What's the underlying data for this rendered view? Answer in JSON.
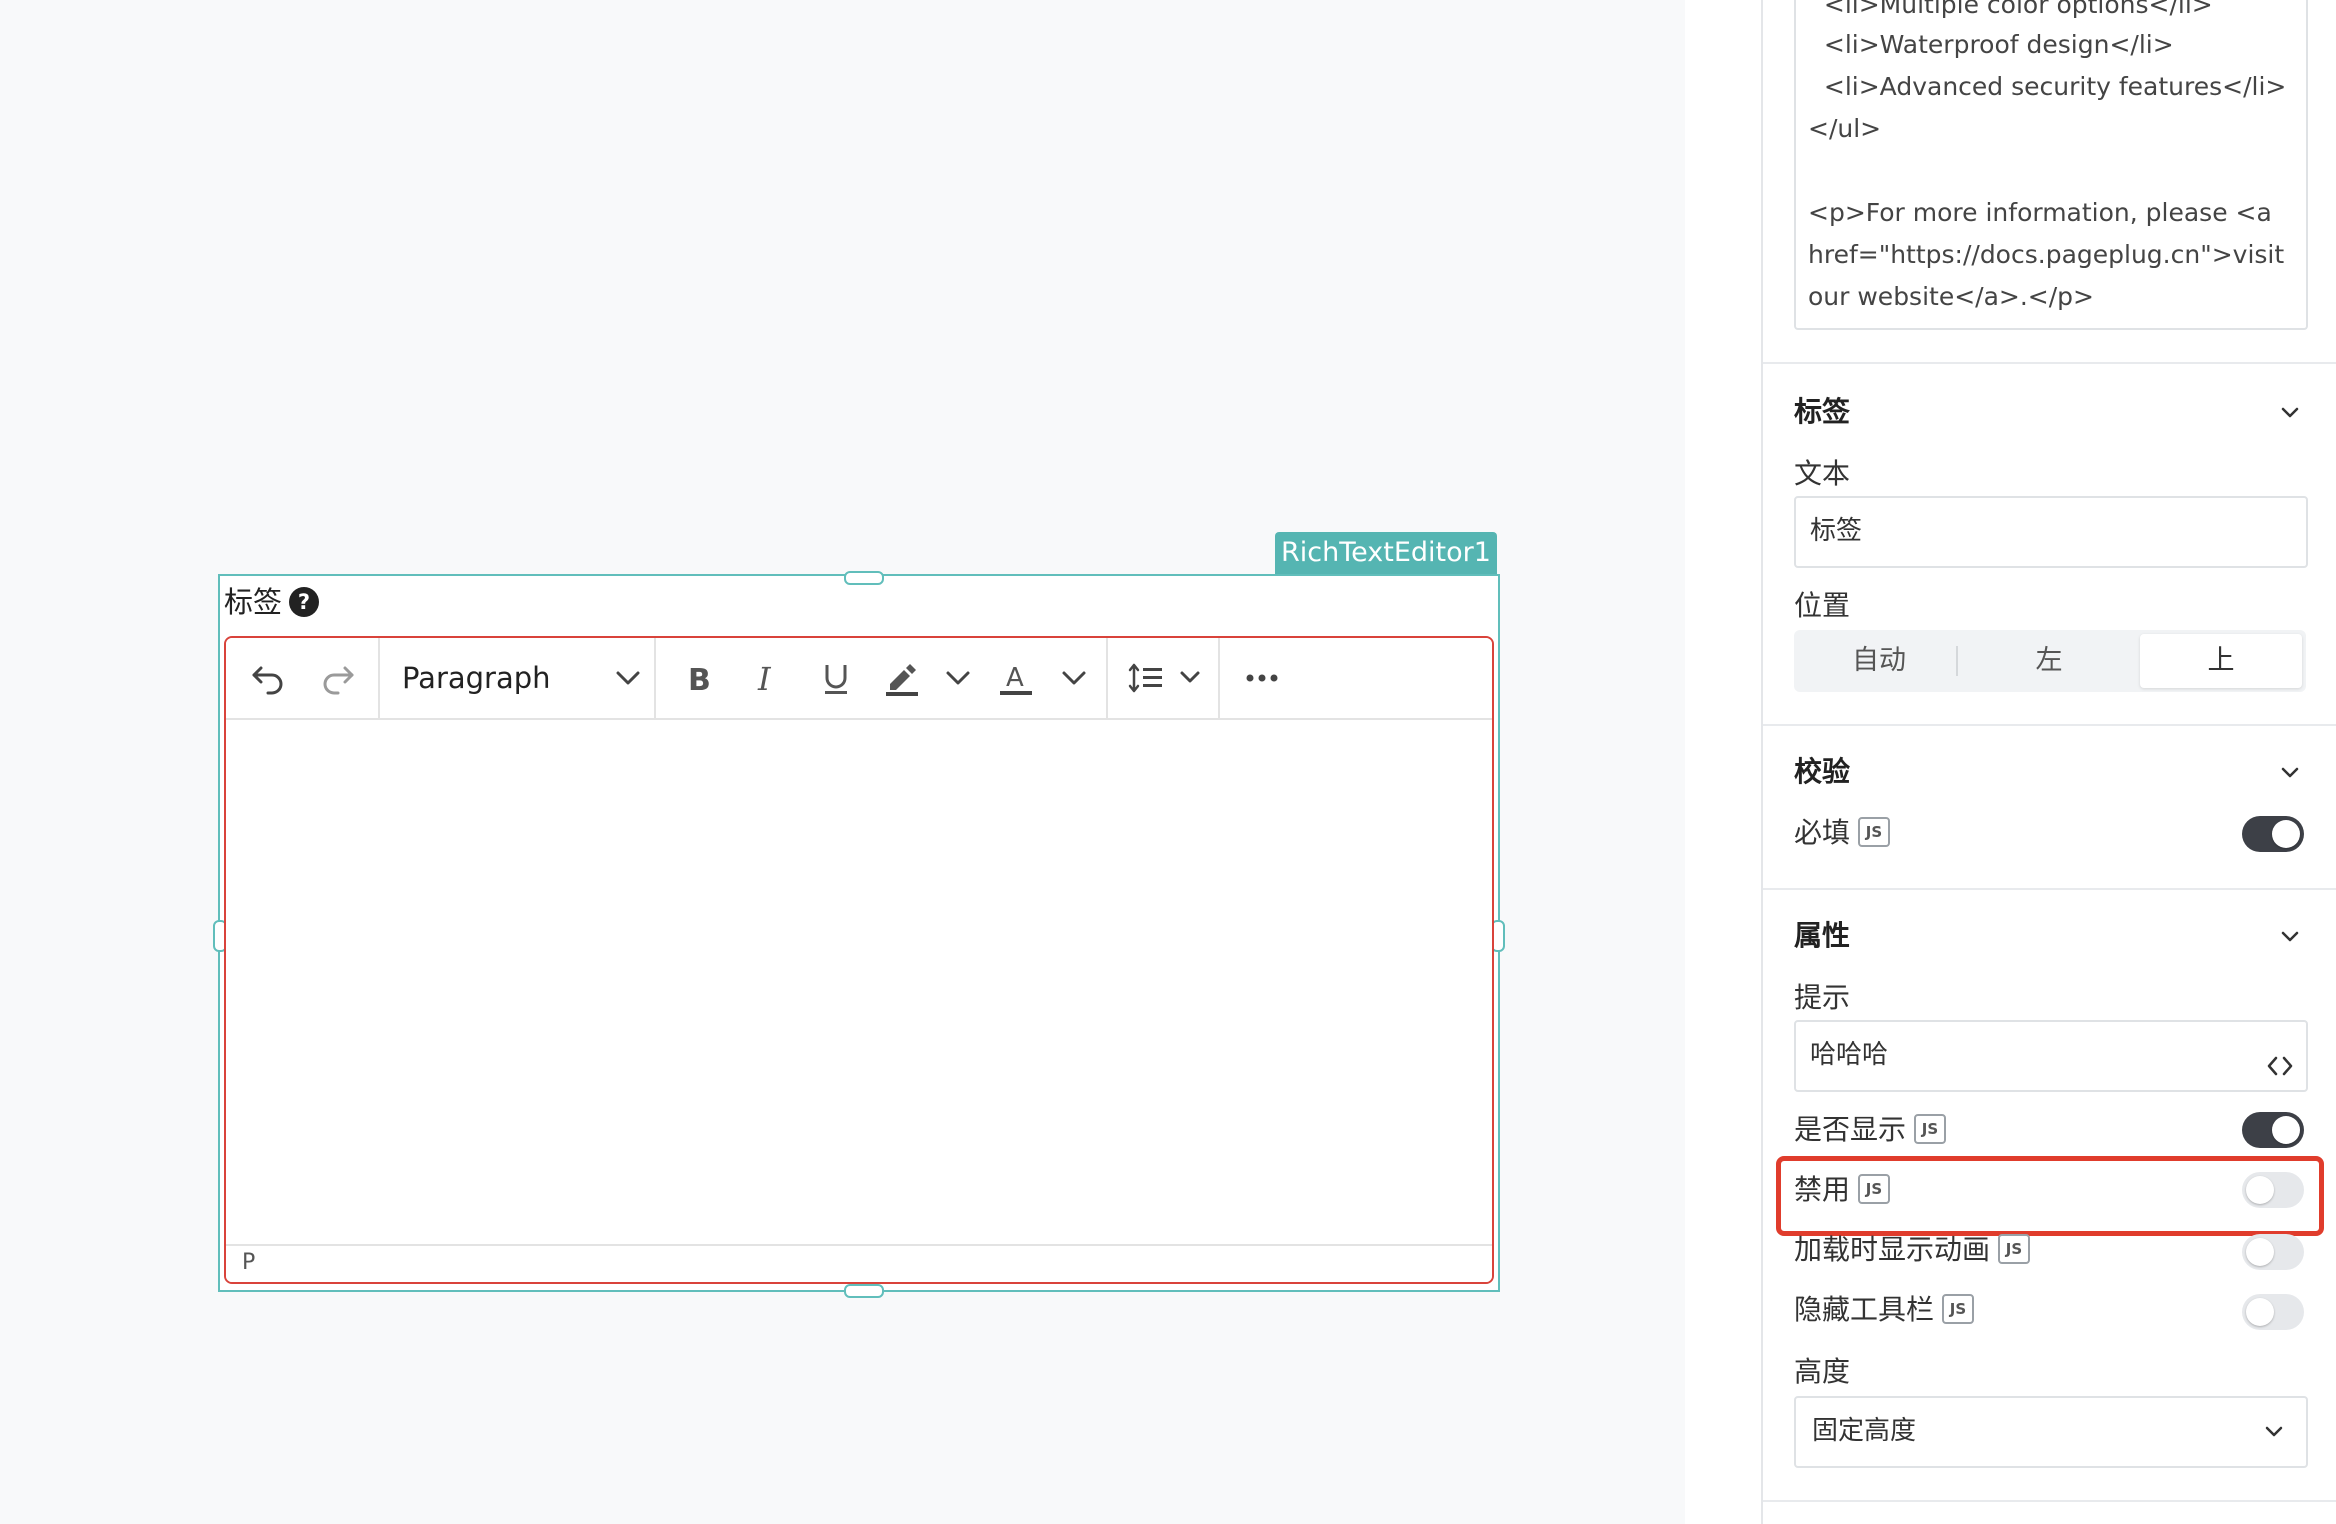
{
  "widget": {
    "name_tag": "RichTextEditor1",
    "label": "标签",
    "help_icon": "question-circle-icon",
    "toolbar": {
      "undo_icon": "undo-icon",
      "redo_icon": "redo-icon",
      "format_value": "Paragraph",
      "bold_icon": "bold-icon",
      "italic_icon": "italic-icon",
      "underline_icon": "underline-icon",
      "highlight_icon": "highlight-color-icon",
      "text_color_icon": "text-color-icon",
      "line_height_icon": "line-height-icon",
      "more_icon": "more-horizontal-icon"
    },
    "status_path": "P"
  },
  "panel": {
    "code_lines": [
      "  <li>Multiple color options</li>",
      "  <li>Waterproof design</li>",
      "  <li>Advanced security features</li>",
      "</ul>",
      "",
      "<p>For more information, please <a",
      "href=\"https://docs.pageplug.cn\">visit",
      "our website</a>.</p>"
    ],
    "label_section": {
      "title": "标签",
      "text_label": "文本",
      "text_value": "标签",
      "position_label": "位置",
      "position_options": [
        "自动",
        "左",
        "上"
      ],
      "position_selected": "上"
    },
    "validation_section": {
      "title": "校验",
      "required_label": "必填",
      "required_on": true
    },
    "props_section": {
      "title": "属性",
      "tooltip_label": "提示",
      "tooltip_value": "哈哈哈",
      "visible_label": "是否显示",
      "visible_on": true,
      "disabled_label": "禁用",
      "disabled_on": false,
      "animate_label": "加载时显示动画",
      "animate_on": false,
      "hide_toolbar_label": "隐藏工具栏",
      "hide_toolbar_on": false,
      "height_label": "高度",
      "height_value": "固定高度"
    },
    "js_badge": "JS"
  },
  "colors": {
    "widget_accent": "#55b5b2",
    "error_border": "#d9433b",
    "highlight_box": "#e03c2c",
    "toggle_on": "#3d4047"
  }
}
